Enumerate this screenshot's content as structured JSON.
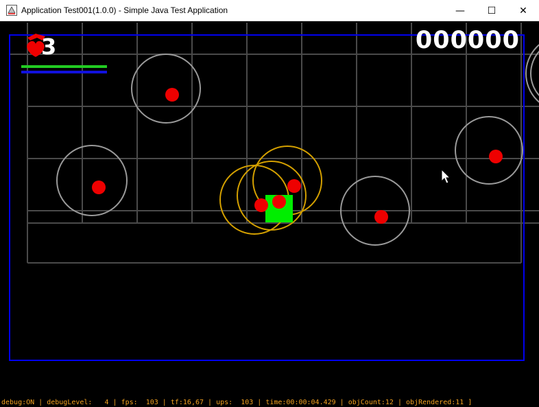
{
  "window": {
    "title": "Application Test001(1.0.0) - Simple Java Test Application",
    "minimize_glyph": "—",
    "maximize_glyph": "☐",
    "close_glyph": "✕",
    "app_icon": "java-app-icon"
  },
  "hud": {
    "lives": "3",
    "score": "000000",
    "lives_icon": "heart-icon",
    "health_bar_color": "#22cc22",
    "energy_bar_color": "#1111dd"
  },
  "debug_line": "debug:ON | debugLevel:   4 | fps:  103 | tf:16,67 | ups:  103 | time:00:00:04.429 | objCount:12 | objRendered:11 ]",
  "colors": {
    "background": "#000000",
    "grid": "#4a4a4a",
    "play_area_border": "#0000ee",
    "enemy": "#ee0000",
    "enemy_ring": "#9a9a9a",
    "player": "#00ee00",
    "player_ring": "#d4a000",
    "hud_text": "#ffffff",
    "debug_text": "#f0a020"
  },
  "cursor_icon": "mouse-pointer-icon"
}
